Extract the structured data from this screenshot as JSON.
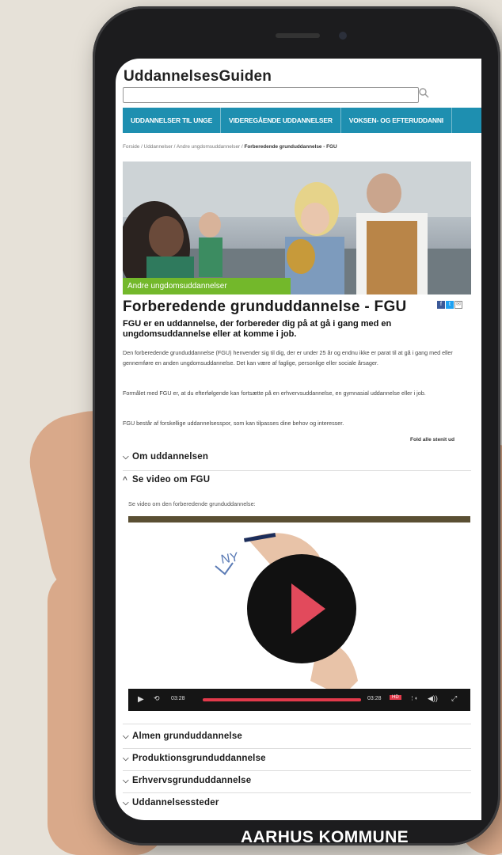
{
  "site": {
    "title": "UddannelsesGuiden",
    "search_placeholder": ""
  },
  "nav": {
    "items": [
      {
        "label": "UDDANNELSER TIL UNGE"
      },
      {
        "label": "VIDEREGÅENDE UDDANNELSER"
      },
      {
        "label": "VOKSEN- OG EFTERUDDANNI"
      }
    ]
  },
  "breadcrumb": {
    "path": "Forside / Uddannelser / Andre ungdomsuddannelser / ",
    "current": "Forberedende grunduddannelse - FGU"
  },
  "hero": {
    "caption": "Andre ungdomsuddannelser"
  },
  "article": {
    "title": "Forberedende grunduddannelse - FGU",
    "subtitle": "FGU er en uddannelse, der forbereder dig på at gå i gang med en ungdomsuddannelse eller at komme i job.",
    "para1": "Den forberedende grunduddannelse (FGU) henvender sig til dig, der er under 25 år og endnu ikke er parat til at gå i gang med eller gennemføre en anden ungdomsuddannelse. Det kan være af faglige, personlige eller sociale årsager.",
    "para2": "Formålet med FGU er, at du efterfølgende kan fortsætte på en erhvervsuddannelse, en gymnasial uddannelse eller i job.",
    "para3": "FGU består af forskellige uddannelsesspor, som kan tilpasses dine behov og interesser.",
    "fold_all": "Fold alle stenit ud"
  },
  "accordion": {
    "item1": "Om uddannelsen",
    "item2": "Se video om FGU",
    "item3": "Almen grunduddannelse",
    "item4": "Produktionsgrunduddannelse",
    "item5": "Erhvervsgrunduddannelse",
    "item6": "Uddannelsessteder"
  },
  "video": {
    "intro": "Se video om den forberedende grunduddannelse:",
    "time_current": "03:28",
    "time_total": "03:28",
    "progress": 1.0,
    "hd_label": "HD"
  },
  "footer_logo": "AARHUS KOMMUNE",
  "colors": {
    "nav_bg": "#1e8fb0",
    "caption_bg": "#73b82b",
    "play_triangle": "#e24a5c",
    "progress": "#e23a4b"
  }
}
